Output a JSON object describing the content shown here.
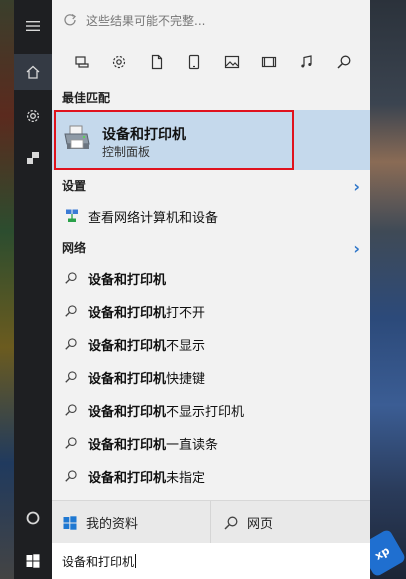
{
  "top_notice": "这些结果可能不完整...",
  "filters": [
    "apps-icon",
    "settings-icon",
    "document-icon",
    "tablet-icon",
    "photo-icon",
    "video-icon",
    "music-icon",
    "search-icon"
  ],
  "sections": {
    "best_match": "最佳匹配",
    "settings": "设置",
    "web": "网络"
  },
  "best_match": {
    "title": "设备和打印机",
    "subtitle": "控制面板"
  },
  "settings_items": [
    {
      "label": "查看网络计算机和设备"
    }
  ],
  "web_suggestions": [
    {
      "bold": "设备和打印机",
      "rest": ""
    },
    {
      "bold": "设备和打印机",
      "rest": "打不开"
    },
    {
      "bold": "设备和打印机",
      "rest": "不显示"
    },
    {
      "bold": "设备和打印机",
      "rest": "快捷键"
    },
    {
      "bold": "设备和打印机",
      "rest": "不显示打印机"
    },
    {
      "bold": "设备和打印机",
      "rest": "一直读条"
    },
    {
      "bold": "设备和打印机",
      "rest": " 未指定"
    }
  ],
  "bottom": {
    "my_stuff": "我的资料",
    "web": "网页"
  },
  "search": {
    "value": "设备和打印机"
  },
  "colors": {
    "accent": "#3077c9",
    "highlight": "#c5d9ec",
    "annotation_frame": "#e0121d"
  }
}
